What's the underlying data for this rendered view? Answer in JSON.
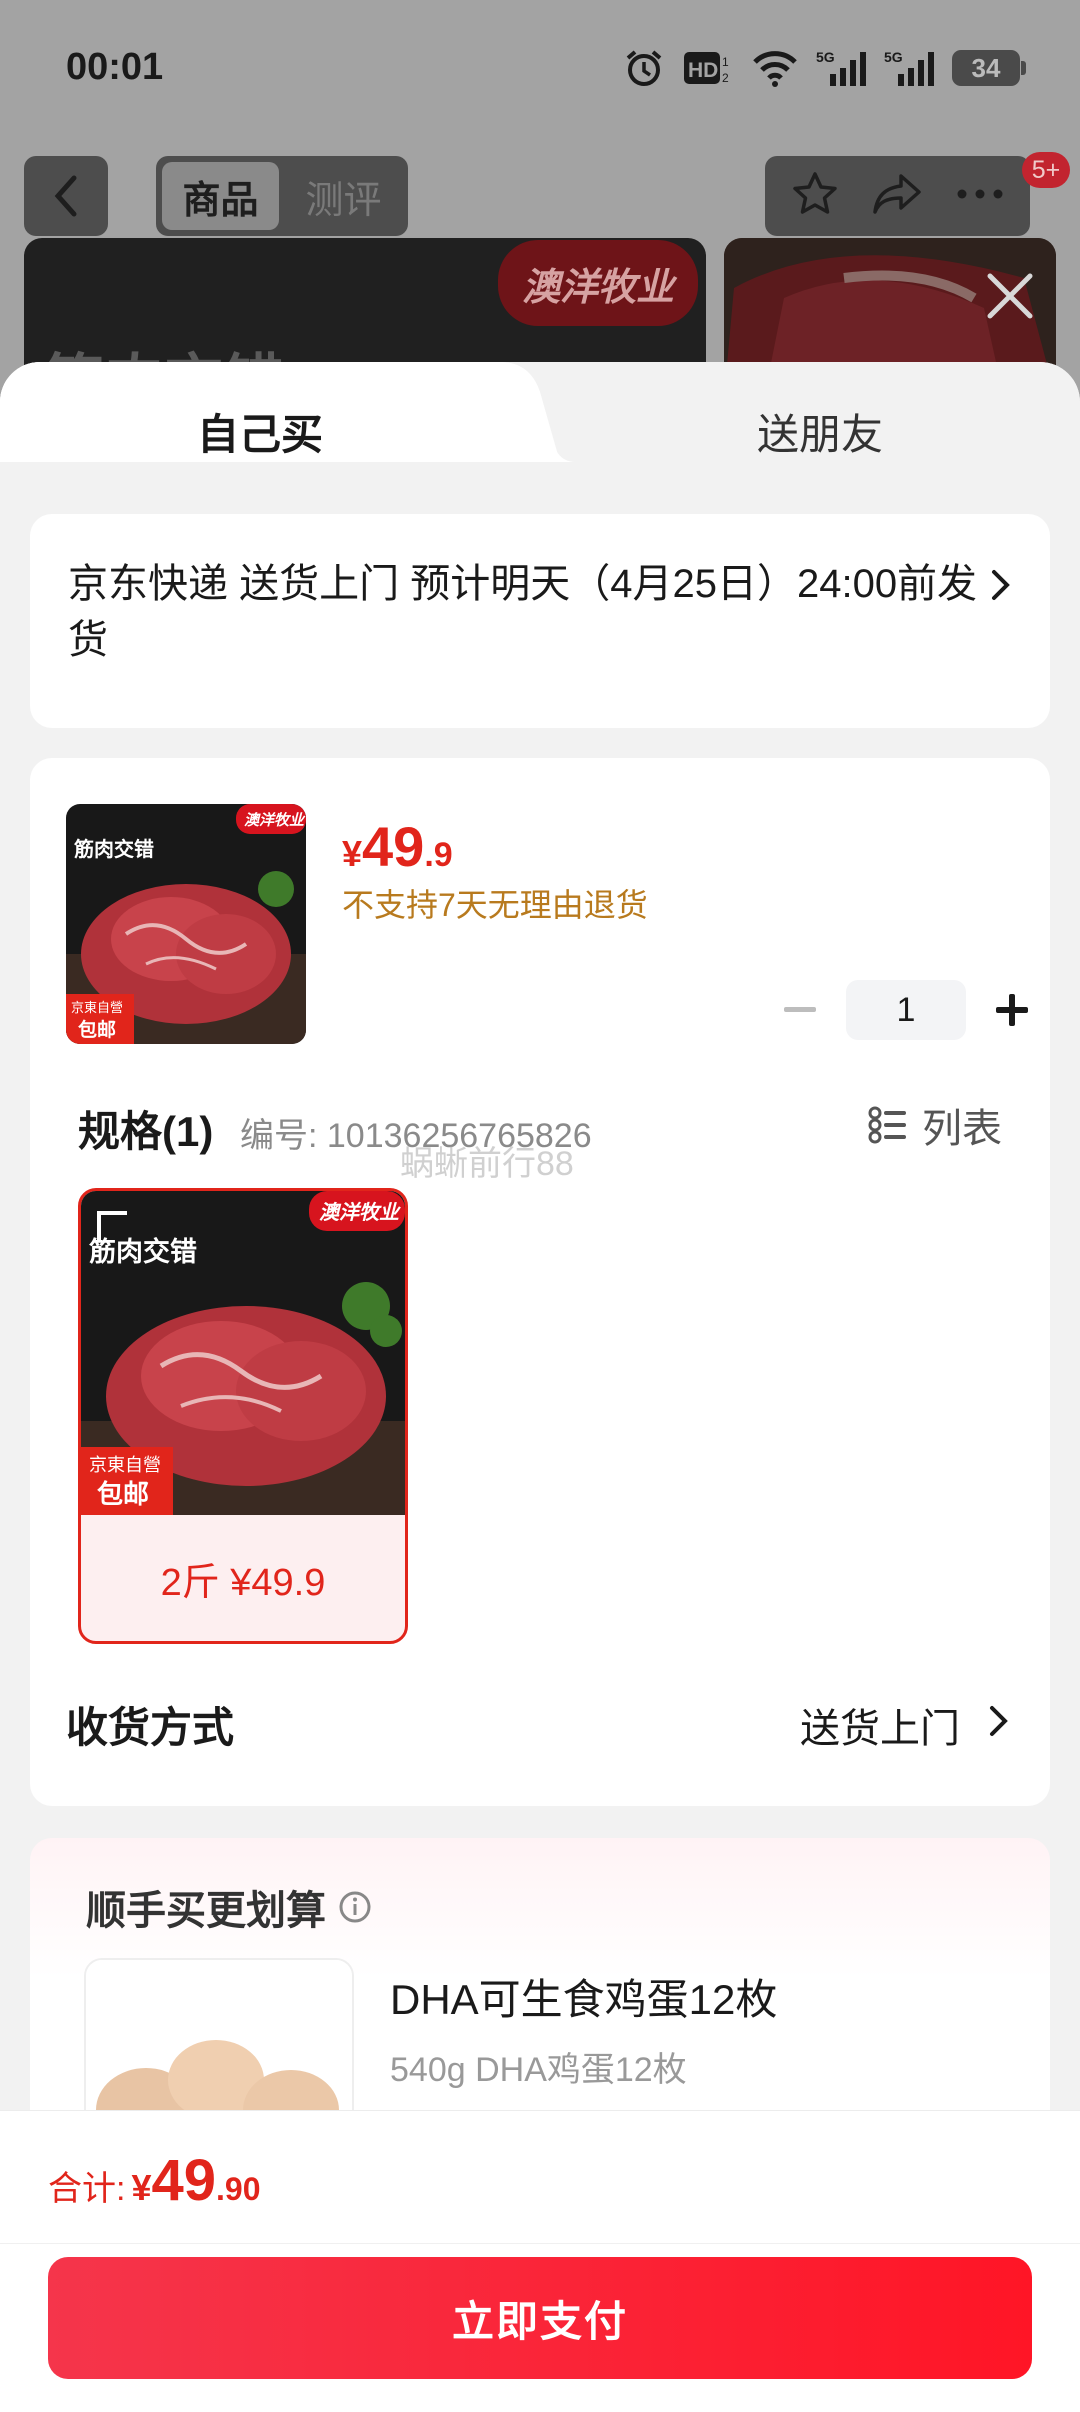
{
  "status_bar": {
    "time": "00:01",
    "hd_label": "HD",
    "network": "5G",
    "battery": "34"
  },
  "nav": {
    "tabs": [
      "商品",
      "测评"
    ],
    "active_tab": 0,
    "badge": "5+"
  },
  "banner": {
    "brand": "澳洋牧业",
    "title": "筋肉交错"
  },
  "sheet_tabs": {
    "self": "自己买",
    "gift": "送朋友"
  },
  "shipping": {
    "text": "京东快递 送货上门 预计明天（4月25日）24:00前发货"
  },
  "product": {
    "price_currency": "¥",
    "price_int": "49",
    "price_dec": ".9",
    "no_return": "不支持7天无理由退货",
    "quantity": "1",
    "image": {
      "title": "筋肉交错",
      "brand": "澳洋牧业",
      "tag_top": "京東自營",
      "tag_bottom": "包邮"
    }
  },
  "spec": {
    "title": "规格(1)",
    "number": "编号: 10136256765826",
    "watermark": "蜗蜥前行88",
    "list_label": "列表",
    "options": [
      {
        "label": "2斤 ¥49.9",
        "selected": true
      }
    ]
  },
  "receive": {
    "label": "收货方式",
    "value": "送货上门"
  },
  "addon": {
    "title": "顺手买更划算",
    "item_name": "DHA可生食鸡蛋12枚",
    "item_sub": "540g DHA鸡蛋12枚"
  },
  "footer": {
    "total_label": "合计:",
    "currency": "¥",
    "total_int": "49",
    "total_dec": ".90",
    "pay_label": "立即支付"
  },
  "colors": {
    "accent": "#e1251b",
    "warning": "#b87a1e",
    "pay_start": "#f5354b",
    "pay_end": "#ff1526"
  }
}
